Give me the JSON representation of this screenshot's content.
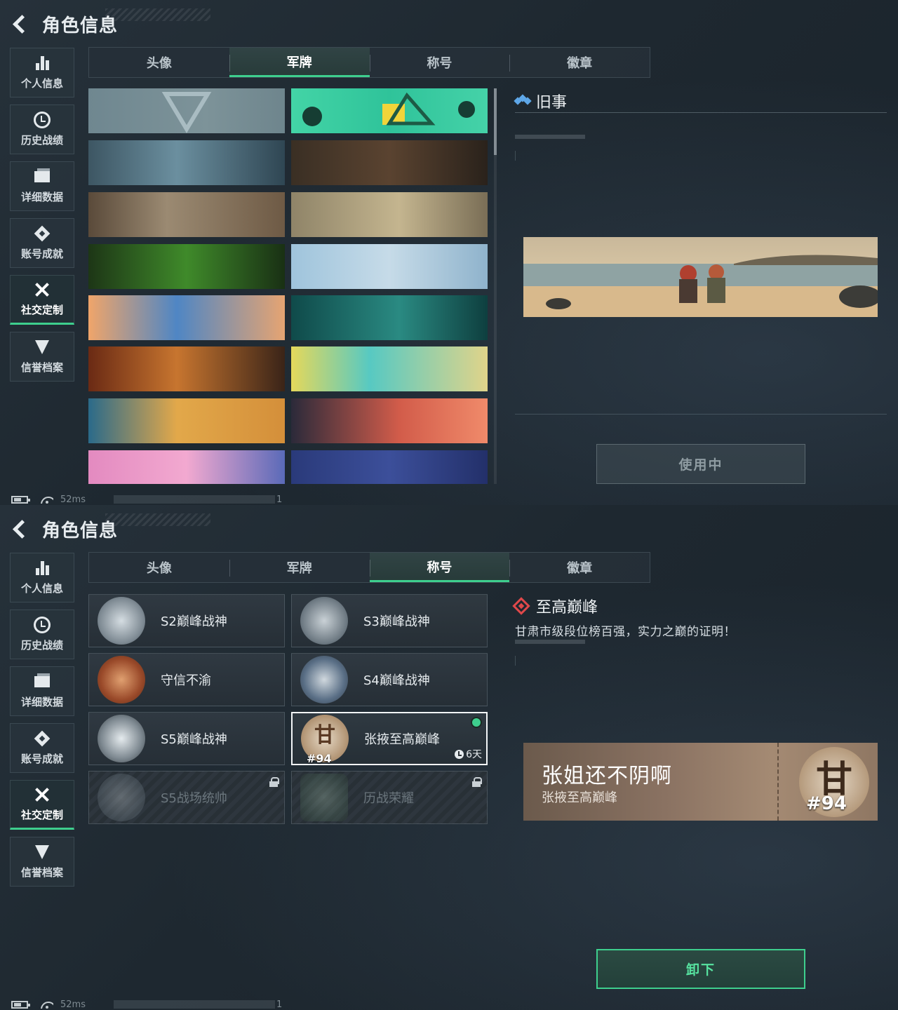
{
  "header": {
    "title": "角色信息"
  },
  "sidebar": {
    "items": [
      {
        "label": "个人信息",
        "icon": "stats-bars-icon"
      },
      {
        "label": "历史战绩",
        "icon": "clock-icon"
      },
      {
        "label": "详细数据",
        "icon": "folder-icon"
      },
      {
        "label": "账号成就",
        "icon": "medal-icon"
      },
      {
        "label": "社交定制",
        "icon": "tools-icon",
        "active": true
      },
      {
        "label": "信誉档案",
        "icon": "shield-icon"
      }
    ]
  },
  "tabs": [
    "头像",
    "军牌",
    "称号",
    "徽章"
  ],
  "top_panel": {
    "active_tab": "军牌",
    "selected_item": {
      "title": "旧事"
    },
    "action_button": "使用中",
    "plaques": [
      {
        "theme": "logo-grey"
      },
      {
        "theme": "cartoon-green"
      },
      {
        "theme": "helicopter-sky"
      },
      {
        "theme": "weapons-crate"
      },
      {
        "theme": "plane-sand"
      },
      {
        "theme": "sniper-desert"
      },
      {
        "theme": "night-vision"
      },
      {
        "theme": "soldier-rocket"
      },
      {
        "theme": "blue-orange-wave"
      },
      {
        "theme": "teal-gym"
      },
      {
        "theme": "fire-soldiers"
      },
      {
        "theme": "headphones-boy"
      },
      {
        "theme": "desert-mech"
      },
      {
        "theme": "sunset-girl"
      },
      {
        "theme": "pink-city"
      },
      {
        "theme": "starry-night-girl"
      }
    ]
  },
  "bottom_panel": {
    "active_tab": "称号",
    "selected_item": {
      "title": "至高巅峰",
      "description": "甘肃市级段位榜百强，实力之巅的证明！"
    },
    "titles": [
      {
        "label": "S2巅峰战神",
        "locked": false
      },
      {
        "label": "S3巅峰战神",
        "locked": false
      },
      {
        "label": "守信不渝",
        "locked": false
      },
      {
        "label": "S4巅峰战神",
        "locked": false
      },
      {
        "label": "S5巅峰战神",
        "locked": false
      },
      {
        "label": "张掖至高巅峰",
        "locked": false,
        "selected": true,
        "timer": "6天",
        "emblem_char": "甘",
        "emblem_num": "#94"
      },
      {
        "label": "S5战场统帅",
        "locked": true
      },
      {
        "label": "历战荣耀",
        "locked": true
      }
    ],
    "nameplate": {
      "name": "张姐还不阴啊",
      "subtitle": "张掖至高巅峰",
      "emblem_char": "甘",
      "emblem_num": "#94"
    },
    "action_button": "卸下"
  },
  "status": {
    "ping": "52ms",
    "tail": "1"
  },
  "colors": {
    "accent": "#3ecf8e",
    "background": "#1c252d",
    "diamond": "#e0484a",
    "info": "#5ea7e8"
  }
}
